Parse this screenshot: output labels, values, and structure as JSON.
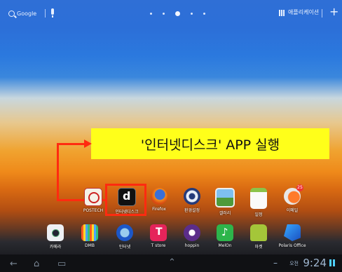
{
  "topbar": {
    "search_label": "Google",
    "apps_label": "애플리케이션",
    "add_label": "+"
  },
  "annotation": {
    "text": "'인터넷디스크' APP 실행"
  },
  "apps_row1": [
    {
      "label": "POSTECH",
      "icon": "postech-icon"
    },
    {
      "label": "인터넷디스크",
      "icon": "internet-disk-icon"
    },
    {
      "label": "Firefox",
      "icon": "firefox-icon"
    },
    {
      "label": "환경설정",
      "icon": "settings-icon"
    },
    {
      "label": "갤러리",
      "icon": "gallery-icon"
    },
    {
      "label": "일정",
      "icon": "calendar-icon"
    },
    {
      "label": "이메일",
      "icon": "email-icon"
    }
  ],
  "apps_row2": [
    {
      "label": "카메라",
      "icon": "camera-icon"
    },
    {
      "label": "DMB",
      "icon": "dmb-icon"
    },
    {
      "label": "인터넷",
      "icon": "internet-icon"
    },
    {
      "label": "T store",
      "icon": "tstore-icon"
    },
    {
      "label": "hoppin",
      "icon": "hoppin-icon"
    },
    {
      "label": "MelOn",
      "icon": "melon-icon"
    },
    {
      "label": "마켓",
      "icon": "market-icon"
    },
    {
      "label": "Polaris Office",
      "icon": "polaris-office-icon"
    }
  ],
  "statusbar": {
    "ampm": "오전",
    "time": "9:24"
  },
  "colors": {
    "highlight": "#ff2b10",
    "callout_bg": "#ffff1a"
  }
}
